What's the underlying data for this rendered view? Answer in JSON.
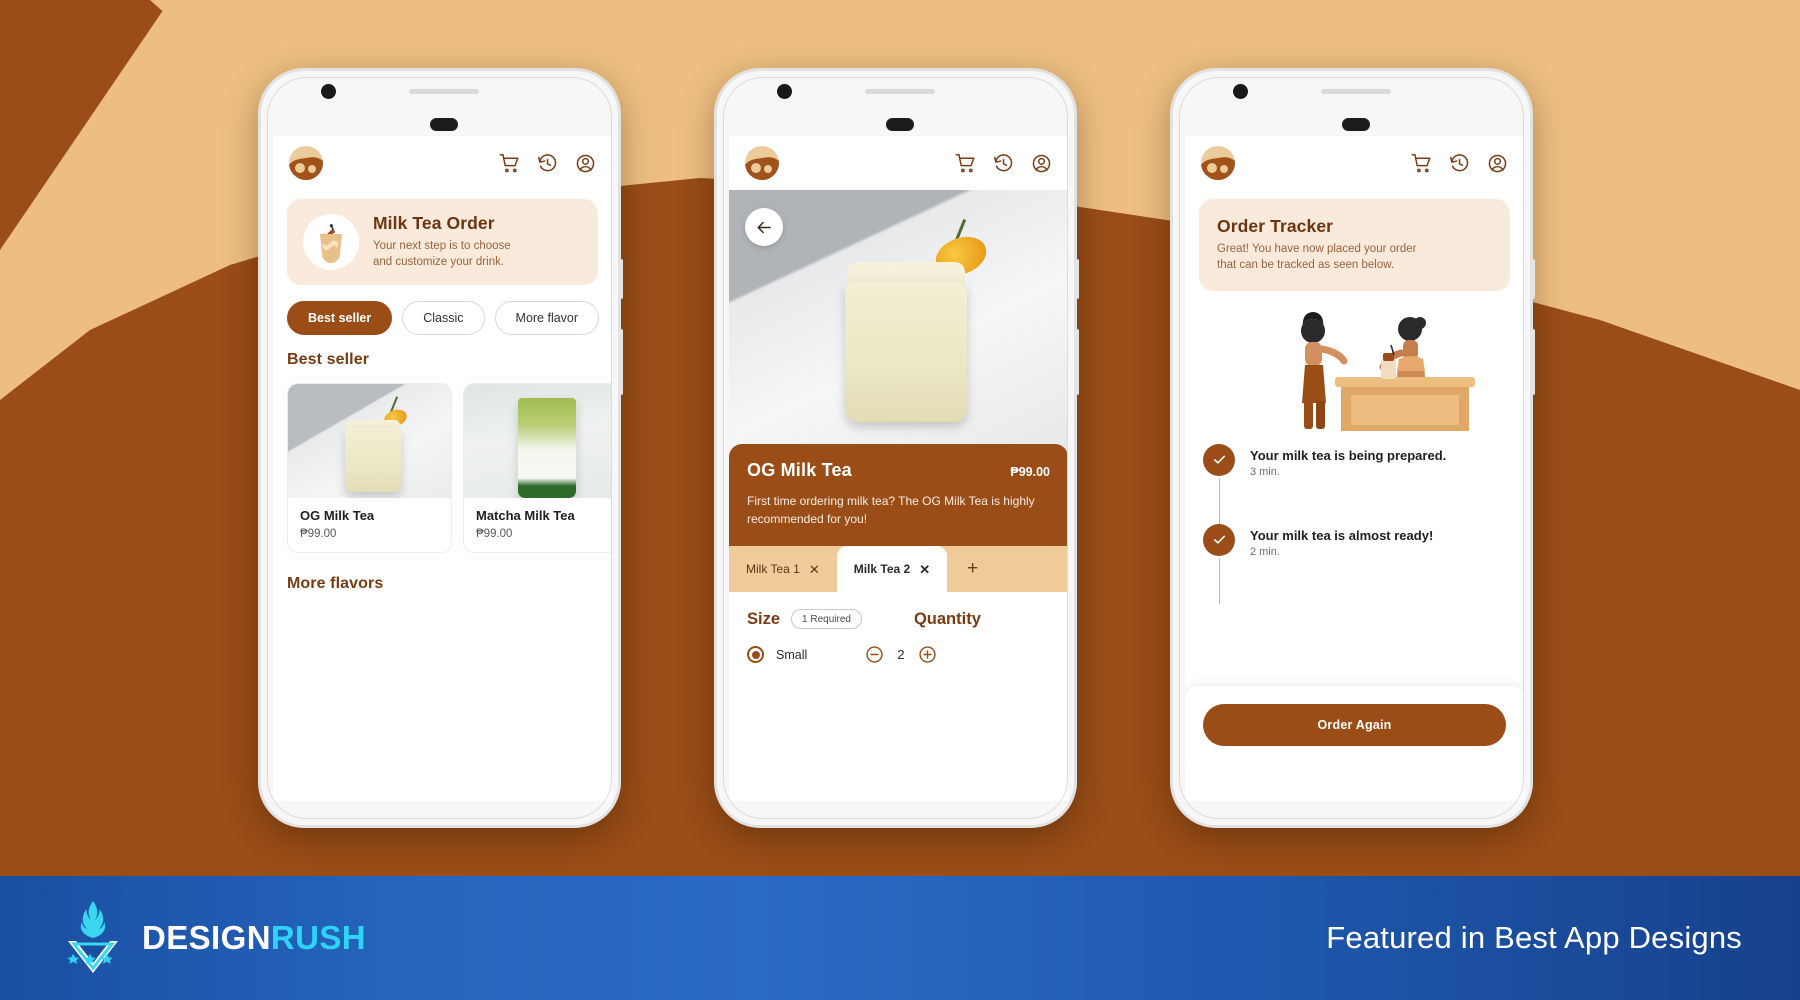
{
  "background": {
    "tan": "#edbe7f",
    "brown": "#9a4d16",
    "accent": "#9a4d16",
    "banner_bg": "#faeadb",
    "tab_bg": "#f0cb9a"
  },
  "phone1": {
    "header": {
      "logo_name": "boba-brand-logo",
      "icons": [
        "cart-icon",
        "history-icon",
        "account-icon"
      ]
    },
    "banner": {
      "title": "Milk Tea Order",
      "line1": "Your next step is to choose",
      "line2": "and customize your drink."
    },
    "chips": [
      {
        "label": "Best seller",
        "active": true
      },
      {
        "label": "Classic",
        "active": false
      },
      {
        "label": "More flavor",
        "active": false
      }
    ],
    "section_title": "Best seller",
    "products": [
      {
        "name": "OG Milk Tea",
        "price": "₱99.00"
      },
      {
        "name": "Matcha Milk Tea",
        "price": "₱99.00"
      }
    ],
    "section_title2": "More flavors"
  },
  "phone2": {
    "back_icon": "back-arrow-icon",
    "detail": {
      "title": "OG Milk Tea",
      "price": "₱99.00",
      "description": "First time ordering milk tea? The OG Milk Tea is highly recommended for you!"
    },
    "tabs": [
      {
        "label": "Milk Tea 1",
        "active": false
      },
      {
        "label": "Milk Tea 2",
        "active": true
      }
    ],
    "tab_add": "+",
    "options": {
      "size_label": "Size",
      "required_badge": "1 Required",
      "quantity_label": "Quantity",
      "size_option": "Small",
      "quantity_value": "2"
    }
  },
  "phone3": {
    "banner": {
      "title": "Order Tracker",
      "line1": "Great! You have now placed your order",
      "line2": "that can be tracked as seen below."
    },
    "tracker": [
      {
        "text": "Your milk tea is being prepared.",
        "time": "3 min."
      },
      {
        "text": "Your milk tea is almost ready!",
        "time": "2 min."
      }
    ],
    "order_again_label": "Order Again"
  },
  "footer": {
    "logo_part1": "DESIGN",
    "logo_part2": "RUSH",
    "tagline": "Featured in Best App Designs"
  }
}
